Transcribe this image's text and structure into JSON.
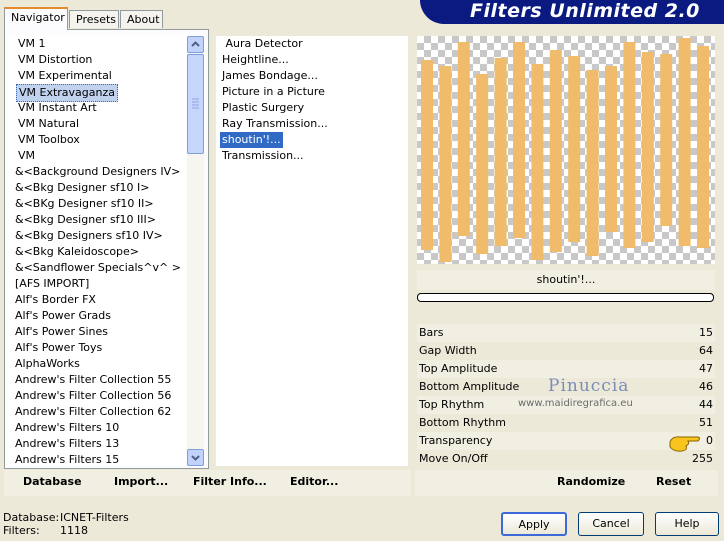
{
  "tabs": [
    {
      "label": "Navigator"
    },
    {
      "label": "Presets"
    },
    {
      "label": "About"
    }
  ],
  "banner": {
    "title": "Filters Unlimited 2.0",
    "bg": "#0a1a80"
  },
  "categories": [
    "VM 1",
    "VM Distortion",
    "VM Experimental",
    "VM Extravaganza",
    "VM Instant Art",
    "VM Natural",
    "VM Toolbox",
    "VM",
    "&<Background Designers IV>",
    "&<Bkg Designer sf10 I>",
    "&<BKg Designer sf10 II>",
    "&<Bkg Designer sf10 III>",
    "&<Bkg Designers sf10 IV>",
    "&<Bkg Kaleidoscope>",
    "&<Sandflower Specials^v^ >",
    "[AFS IMPORT]",
    "Alf's Border FX",
    "Alf's Power Grads",
    "Alf's Power Sines",
    "Alf's Power Toys",
    "AlphaWorks",
    "Andrew's Filter Collection 55",
    "Andrew's Filter Collection 56",
    "Andrew's Filter Collection 62",
    "Andrew's Filters 10",
    "Andrew's Filters 13",
    "Andrew's Filters 15"
  ],
  "selected_category_index": 3,
  "filters": [
    " Aura Detector",
    "Heightline...",
    "James Bondage...",
    "Picture in a Picture",
    "Plastic Surgery",
    "Ray Transmission...",
    "shoutin'!...",
    "Transmission..."
  ],
  "selected_filter_index": 6,
  "preview": {
    "bar_color": "#f0bc6c",
    "filter_name": "shoutin'!..."
  },
  "params": [
    {
      "label": "Bars",
      "value": "15"
    },
    {
      "label": "Gap Width",
      "value": "64"
    },
    {
      "label": "Top Amplitude",
      "value": "47"
    },
    {
      "label": "Bottom Amplitude",
      "value": "46"
    },
    {
      "label": "Top Rhythm",
      "value": "44"
    },
    {
      "label": "Bottom Rhythm",
      "value": "51"
    },
    {
      "label": "Transparency",
      "value": "0"
    },
    {
      "label": "Move On/Off",
      "value": "255"
    }
  ],
  "watermark": {
    "name": "Pinuccia",
    "site": "www.maidiregrafica.eu"
  },
  "toolbar": {
    "database": "Database",
    "import": "Import...",
    "filter_info": "Filter Info...",
    "editor": "Editor...",
    "randomize": "Randomize",
    "reset": "Reset"
  },
  "status": {
    "database_label": "Database:",
    "database_value": "ICNET-Filters",
    "filters_label": "Filters:",
    "filters_value": "1118"
  },
  "buttons": {
    "apply": "Apply",
    "cancel": "Cancel",
    "help": "Help"
  }
}
